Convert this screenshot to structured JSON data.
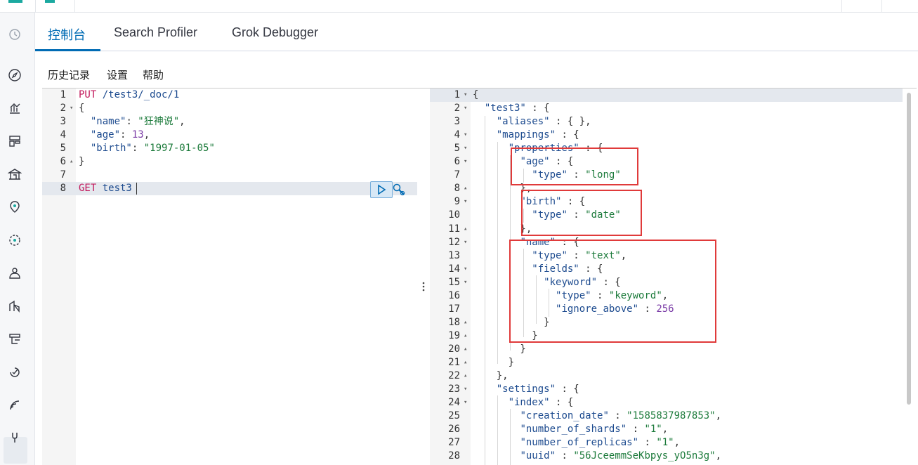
{
  "colors": {
    "accent": "#006bb4",
    "brand": "#1ba9a0",
    "highlight": "#e03a3a"
  },
  "tabs": [
    {
      "label": "控制台",
      "active": true
    },
    {
      "label": "Search Profiler",
      "active": false
    },
    {
      "label": "Grok Debugger",
      "active": false
    }
  ],
  "subnav": {
    "history": "历史记录",
    "settings": "设置",
    "help": "帮助"
  },
  "nav_icons": [
    "clock-icon",
    "compass-icon",
    "visualize-icon",
    "dashboard-icon",
    "canvas-icon",
    "maps-icon",
    "ml-icon",
    "metrics-icon",
    "logs-icon",
    "uptime-icon",
    "apm-icon",
    "siem-icon",
    "devtools-icon"
  ],
  "request": {
    "lines": [
      {
        "n": "1",
        "fold": "",
        "tokens": [
          [
            "m",
            "PUT "
          ],
          [
            "k",
            "/test3/_doc/1"
          ]
        ]
      },
      {
        "n": "2",
        "fold": "▾",
        "tokens": [
          [
            "p",
            "{"
          ]
        ]
      },
      {
        "n": "3",
        "fold": "",
        "tokens": [
          [
            "p",
            "  "
          ],
          [
            "k",
            "\"name\""
          ],
          [
            "p",
            ": "
          ],
          [
            "s",
            "\"狂神说\""
          ],
          [
            "p",
            ","
          ]
        ]
      },
      {
        "n": "4",
        "fold": "",
        "tokens": [
          [
            "p",
            "  "
          ],
          [
            "k",
            "\"age\""
          ],
          [
            "p",
            ": "
          ],
          [
            "n",
            "13"
          ],
          [
            "p",
            ","
          ]
        ]
      },
      {
        "n": "5",
        "fold": "",
        "tokens": [
          [
            "p",
            "  "
          ],
          [
            "k",
            "\"birth\""
          ],
          [
            "p",
            ": "
          ],
          [
            "s",
            "\"1997-01-05\""
          ]
        ]
      },
      {
        "n": "6",
        "fold": "▴",
        "tokens": [
          [
            "p",
            "}"
          ]
        ]
      },
      {
        "n": "7",
        "fold": "",
        "tokens": []
      },
      {
        "n": "8",
        "fold": "",
        "tokens": [
          [
            "m",
            "GET "
          ],
          [
            "k",
            "test3"
          ]
        ]
      }
    ]
  },
  "response": {
    "lines": [
      {
        "n": "1",
        "fold": "▾",
        "tokens": [
          [
            "p",
            "{"
          ]
        ]
      },
      {
        "n": "2",
        "fold": "▾",
        "tokens": [
          [
            "p",
            "  "
          ],
          [
            "k",
            "\"test3\""
          ],
          [
            "p",
            " : {"
          ]
        ]
      },
      {
        "n": "3",
        "fold": "",
        "tokens": [
          [
            "p",
            "    "
          ],
          [
            "k",
            "\"aliases\""
          ],
          [
            "p",
            " : { },"
          ]
        ]
      },
      {
        "n": "4",
        "fold": "▾",
        "tokens": [
          [
            "p",
            "    "
          ],
          [
            "k",
            "\"mappings\""
          ],
          [
            "p",
            " : {"
          ]
        ]
      },
      {
        "n": "5",
        "fold": "▾",
        "tokens": [
          [
            "p",
            "      "
          ],
          [
            "k",
            "\"properties\""
          ],
          [
            "p",
            " : {"
          ]
        ]
      },
      {
        "n": "6",
        "fold": "▾",
        "tokens": [
          [
            "p",
            "        "
          ],
          [
            "k",
            "\"age\""
          ],
          [
            "p",
            " : {"
          ]
        ]
      },
      {
        "n": "7",
        "fold": "",
        "tokens": [
          [
            "p",
            "          "
          ],
          [
            "k",
            "\"type\""
          ],
          [
            "p",
            " : "
          ],
          [
            "s",
            "\"long\""
          ]
        ]
      },
      {
        "n": "8",
        "fold": "▴",
        "tokens": [
          [
            "p",
            "        },"
          ]
        ]
      },
      {
        "n": "9",
        "fold": "▾",
        "tokens": [
          [
            "p",
            "        "
          ],
          [
            "k",
            "\"birth\""
          ],
          [
            "p",
            " : {"
          ]
        ]
      },
      {
        "n": "10",
        "fold": "",
        "tokens": [
          [
            "p",
            "          "
          ],
          [
            "k",
            "\"type\""
          ],
          [
            "p",
            " : "
          ],
          [
            "s",
            "\"date\""
          ]
        ]
      },
      {
        "n": "11",
        "fold": "▴",
        "tokens": [
          [
            "p",
            "        },"
          ]
        ]
      },
      {
        "n": "12",
        "fold": "▾",
        "tokens": [
          [
            "p",
            "        "
          ],
          [
            "k",
            "\"name\""
          ],
          [
            "p",
            " : {"
          ]
        ]
      },
      {
        "n": "13",
        "fold": "",
        "tokens": [
          [
            "p",
            "          "
          ],
          [
            "k",
            "\"type\""
          ],
          [
            "p",
            " : "
          ],
          [
            "s",
            "\"text\""
          ],
          [
            "p",
            ","
          ]
        ]
      },
      {
        "n": "14",
        "fold": "▾",
        "tokens": [
          [
            "p",
            "          "
          ],
          [
            "k",
            "\"fields\""
          ],
          [
            "p",
            " : {"
          ]
        ]
      },
      {
        "n": "15",
        "fold": "▾",
        "tokens": [
          [
            "p",
            "            "
          ],
          [
            "k",
            "\"keyword\""
          ],
          [
            "p",
            " : {"
          ]
        ]
      },
      {
        "n": "16",
        "fold": "",
        "tokens": [
          [
            "p",
            "              "
          ],
          [
            "k",
            "\"type\""
          ],
          [
            "p",
            " : "
          ],
          [
            "s",
            "\"keyword\""
          ],
          [
            "p",
            ","
          ]
        ]
      },
      {
        "n": "17",
        "fold": "",
        "tokens": [
          [
            "p",
            "              "
          ],
          [
            "k",
            "\"ignore_above\""
          ],
          [
            "p",
            " : "
          ],
          [
            "n",
            "256"
          ]
        ]
      },
      {
        "n": "18",
        "fold": "▴",
        "tokens": [
          [
            "p",
            "            }"
          ]
        ]
      },
      {
        "n": "19",
        "fold": "▴",
        "tokens": [
          [
            "p",
            "          }"
          ]
        ]
      },
      {
        "n": "20",
        "fold": "▴",
        "tokens": [
          [
            "p",
            "        }"
          ]
        ]
      },
      {
        "n": "21",
        "fold": "▴",
        "tokens": [
          [
            "p",
            "      }"
          ]
        ]
      },
      {
        "n": "22",
        "fold": "▴",
        "tokens": [
          [
            "p",
            "    },"
          ]
        ]
      },
      {
        "n": "23",
        "fold": "▾",
        "tokens": [
          [
            "p",
            "    "
          ],
          [
            "k",
            "\"settings\""
          ],
          [
            "p",
            " : {"
          ]
        ]
      },
      {
        "n": "24",
        "fold": "▾",
        "tokens": [
          [
            "p",
            "      "
          ],
          [
            "k",
            "\"index\""
          ],
          [
            "p",
            " : {"
          ]
        ]
      },
      {
        "n": "25",
        "fold": "",
        "tokens": [
          [
            "p",
            "        "
          ],
          [
            "k",
            "\"creation_date\""
          ],
          [
            "p",
            " : "
          ],
          [
            "s",
            "\"1585837987853\""
          ],
          [
            "p",
            ","
          ]
        ]
      },
      {
        "n": "26",
        "fold": "",
        "tokens": [
          [
            "p",
            "        "
          ],
          [
            "k",
            "\"number_of_shards\""
          ],
          [
            "p",
            " : "
          ],
          [
            "s",
            "\"1\""
          ],
          [
            "p",
            ","
          ]
        ]
      },
      {
        "n": "27",
        "fold": "",
        "tokens": [
          [
            "p",
            "        "
          ],
          [
            "k",
            "\"number_of_replicas\""
          ],
          [
            "p",
            " : "
          ],
          [
            "s",
            "\"1\""
          ],
          [
            "p",
            ","
          ]
        ]
      },
      {
        "n": "28",
        "fold": "",
        "tokens": [
          [
            "p",
            "        "
          ],
          [
            "k",
            "\"uuid\""
          ],
          [
            "p",
            " : "
          ],
          [
            "s",
            "\"56JceemmSeKbpys_yO5n3g\""
          ],
          [
            "p",
            ","
          ]
        ]
      }
    ]
  }
}
